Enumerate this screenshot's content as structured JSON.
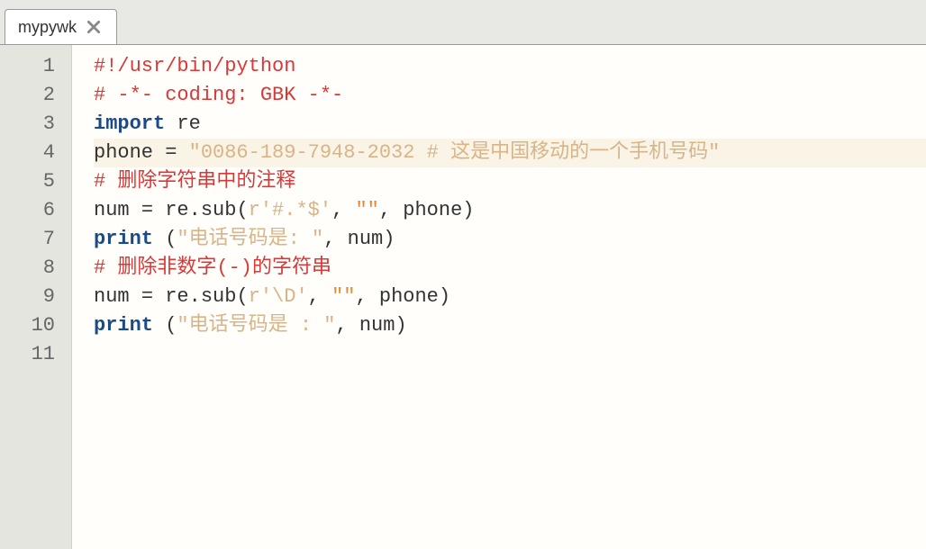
{
  "tab": {
    "title": "mypywk"
  },
  "gutter": {
    "lines": [
      "1",
      "2",
      "3",
      "4",
      "5",
      "6",
      "7",
      "8",
      "9",
      "10",
      "11"
    ]
  },
  "code": {
    "lines": [
      {
        "highlighted": false,
        "tokens": [
          {
            "cls": "tk-comment",
            "t": "#!/usr/bin/python"
          }
        ]
      },
      {
        "highlighted": false,
        "tokens": [
          {
            "cls": "tk-comment",
            "t": "# -*- coding: GBK -*-"
          }
        ]
      },
      {
        "highlighted": false,
        "tokens": [
          {
            "cls": "tk-keyword",
            "t": "import"
          },
          {
            "cls": "tk-var",
            "t": " re"
          }
        ]
      },
      {
        "highlighted": true,
        "tokens": [
          {
            "cls": "tk-var",
            "t": "phone "
          },
          {
            "cls": "tk-op",
            "t": "="
          },
          {
            "cls": "tk-var",
            "t": " "
          },
          {
            "cls": "tk-string-faded",
            "t": "\"0086-189-7948-2032 # 这是中国移动的一个手机号码\""
          }
        ]
      },
      {
        "highlighted": false,
        "tokens": [
          {
            "cls": "tk-comment",
            "t": "# 删除字符串中的注释"
          }
        ]
      },
      {
        "highlighted": false,
        "tokens": [
          {
            "cls": "tk-var",
            "t": "num "
          },
          {
            "cls": "tk-op",
            "t": "="
          },
          {
            "cls": "tk-var",
            "t": " re.sub"
          },
          {
            "cls": "tk-paren",
            "t": "("
          },
          {
            "cls": "tk-rawprefix",
            "t": "r'#.*$'"
          },
          {
            "cls": "tk-punct",
            "t": ", "
          },
          {
            "cls": "tk-string",
            "t": "\"\""
          },
          {
            "cls": "tk-punct",
            "t": ", phone"
          },
          {
            "cls": "tk-paren",
            "t": ")"
          }
        ]
      },
      {
        "highlighted": false,
        "tokens": [
          {
            "cls": "tk-keyword",
            "t": "print"
          },
          {
            "cls": "tk-var",
            "t": " "
          },
          {
            "cls": "tk-paren",
            "t": "("
          },
          {
            "cls": "tk-string-faded",
            "t": "\"电话号码是: \""
          },
          {
            "cls": "tk-punct",
            "t": ", num"
          },
          {
            "cls": "tk-paren",
            "t": ")"
          }
        ]
      },
      {
        "highlighted": false,
        "tokens": [
          {
            "cls": "tk-comment",
            "t": "# 删除非数字(-)的字符串"
          }
        ]
      },
      {
        "highlighted": false,
        "tokens": [
          {
            "cls": "tk-var",
            "t": "num "
          },
          {
            "cls": "tk-op",
            "t": "="
          },
          {
            "cls": "tk-var",
            "t": " re.sub"
          },
          {
            "cls": "tk-paren",
            "t": "("
          },
          {
            "cls": "tk-rawprefix",
            "t": "r'\\D'"
          },
          {
            "cls": "tk-punct",
            "t": ", "
          },
          {
            "cls": "tk-string",
            "t": "\"\""
          },
          {
            "cls": "tk-punct",
            "t": ", phone"
          },
          {
            "cls": "tk-paren",
            "t": ")"
          }
        ]
      },
      {
        "highlighted": false,
        "tokens": [
          {
            "cls": "tk-keyword",
            "t": "print"
          },
          {
            "cls": "tk-var",
            "t": " "
          },
          {
            "cls": "tk-paren",
            "t": "("
          },
          {
            "cls": "tk-string-faded",
            "t": "\"电话号码是 : \""
          },
          {
            "cls": "tk-punct",
            "t": ", num"
          },
          {
            "cls": "tk-paren",
            "t": ")"
          }
        ]
      },
      {
        "highlighted": false,
        "tokens": []
      }
    ]
  }
}
